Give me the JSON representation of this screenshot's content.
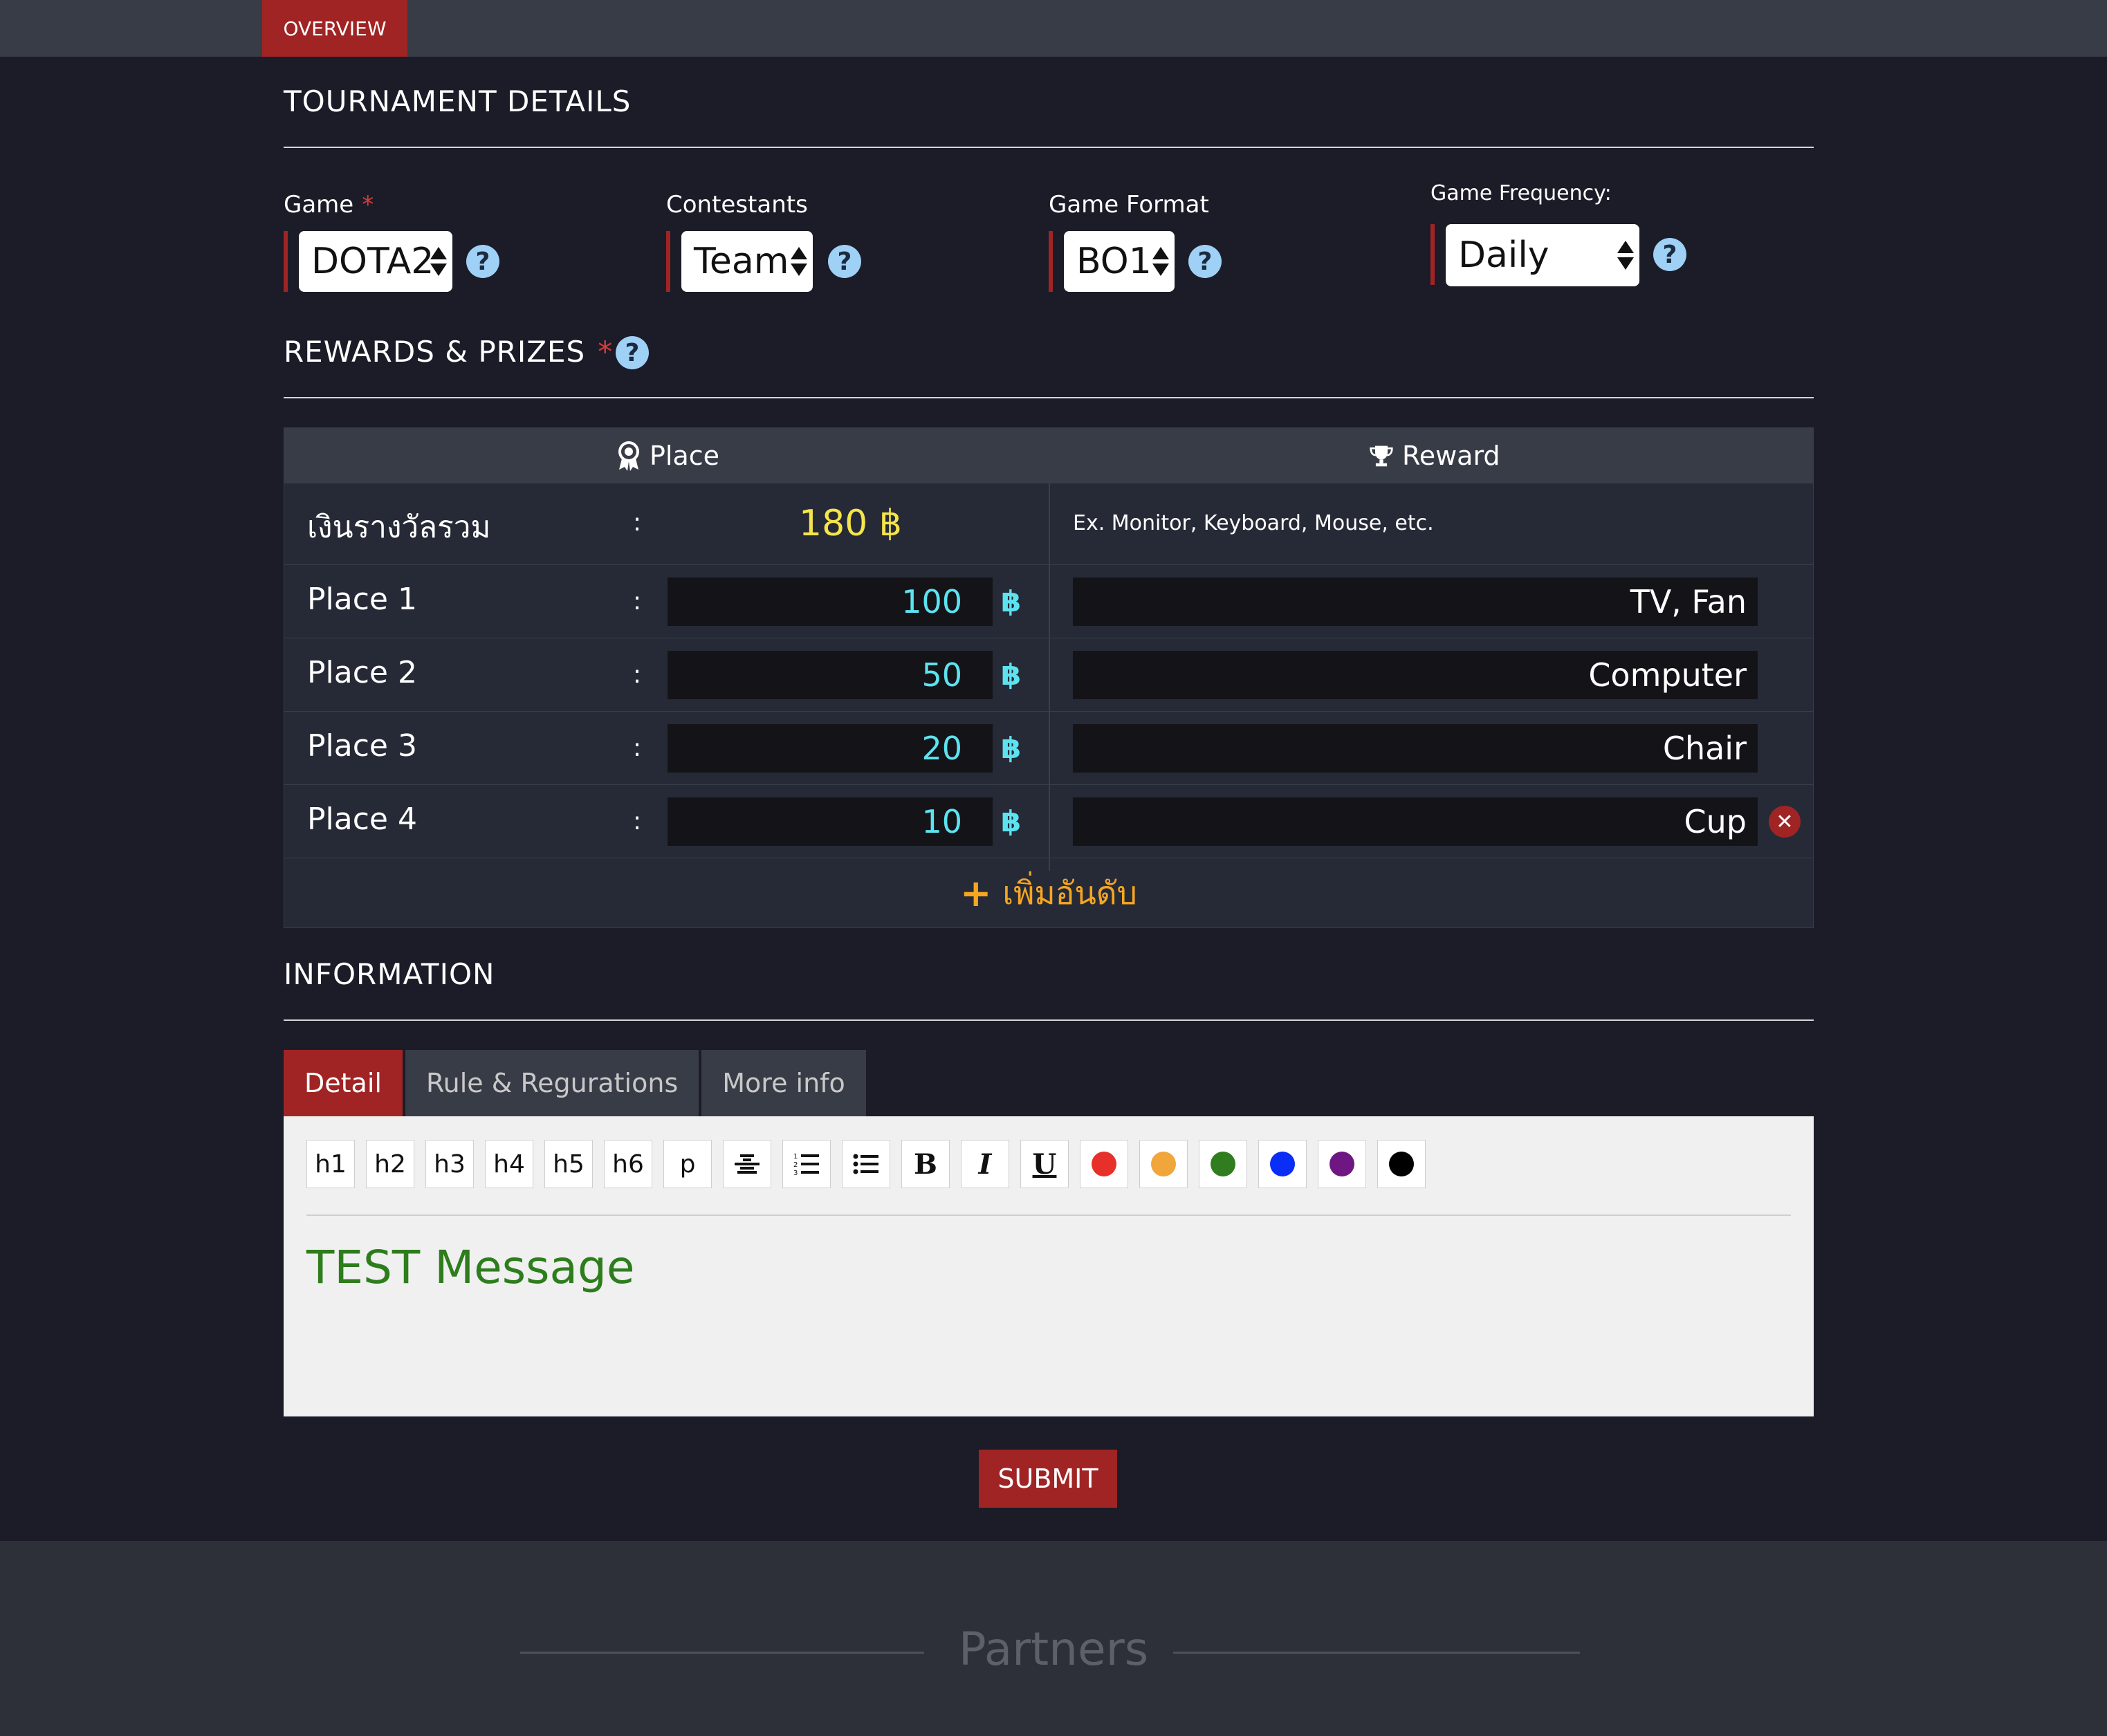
{
  "nav": {
    "overview_tab": "OVERVIEW"
  },
  "tournament_details": {
    "title": "TOURNAMENT DETAILS",
    "required_mark": "*",
    "fields": {
      "game": {
        "label": "Game",
        "value": "DOTA2"
      },
      "contestants": {
        "label": "Contestants",
        "value": "Team"
      },
      "game_format": {
        "label": "Game Format",
        "value": "BO1"
      },
      "game_frequency": {
        "label": "Game Frequency:",
        "value": "Daily"
      }
    },
    "help_icon": "?"
  },
  "rewards": {
    "title": "REWARDS & PRIZES",
    "required_mark": "*",
    "header": {
      "place": "Place",
      "reward": "Reward"
    },
    "total": {
      "label": "เงินรางวัลรวม",
      "colon": ":",
      "amount": "180 ฿",
      "reward_placeholder": "Ex. Monitor, Keyboard, Mouse, etc."
    },
    "currency_symbol": "฿",
    "places": [
      {
        "label": "Place 1",
        "colon": ":",
        "amount": "100",
        "reward": "TV, Fan"
      },
      {
        "label": "Place 2",
        "colon": ":",
        "amount": "50",
        "reward": "Computer"
      },
      {
        "label": "Place 3",
        "colon": ":",
        "amount": "20",
        "reward": "Chair"
      },
      {
        "label": "Place 4",
        "colon": ":",
        "amount": "10",
        "reward": "Cup"
      }
    ],
    "add_rank": {
      "icon": "+",
      "label": "เพิ่มอันดับ"
    }
  },
  "information": {
    "title": "INFORMATION",
    "tabs": [
      {
        "label": "Detail",
        "active": true
      },
      {
        "label": "Rule & Regurations",
        "active": false
      },
      {
        "label": "More info",
        "active": false
      }
    ],
    "toolbar": {
      "headings": [
        "h1",
        "h2",
        "h3",
        "h4",
        "h5",
        "h6",
        "p"
      ],
      "format_icons": [
        "strikethrough-icon",
        "ordered-list-icon",
        "unordered-list-icon"
      ],
      "bold": "B",
      "italic": "I",
      "underline": "U",
      "colors": [
        "#e8302a",
        "#f0a63a",
        "#2f7d1f",
        "#0a2ef5",
        "#6e1782",
        "#000000"
      ]
    },
    "content": "TEST Message",
    "content_color": "#2e7d1c"
  },
  "submit": {
    "label": "SUBMIT"
  },
  "footer": {
    "title": "Partners"
  },
  "theme": {
    "accent": "#a02424",
    "background": "#1b1c28",
    "cyan": "#5de3f0",
    "gold": "#f6e54a",
    "orange": "#f5a623"
  }
}
